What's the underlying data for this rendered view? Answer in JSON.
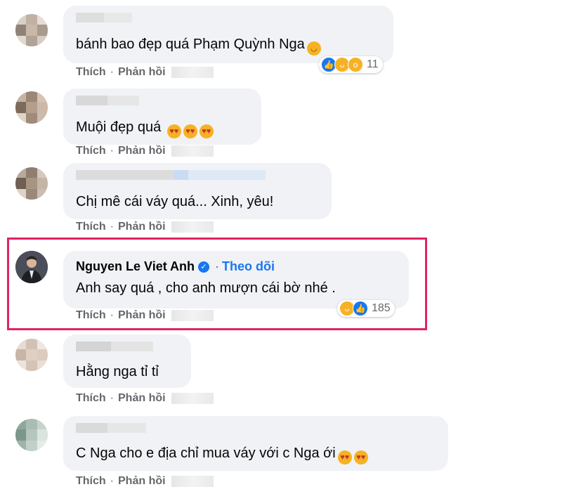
{
  "actions": {
    "like": "Thích",
    "sep": "·",
    "reply": "Phản hồi"
  },
  "comments": [
    {
      "text": "bánh bao đẹp quá Phạm Quỳnh Nga",
      "reaction_count": "11"
    },
    {
      "text": "Muội đẹp quá"
    },
    {
      "text": "Chị mê cái váy quá... Xinh, yêu!"
    },
    {
      "author": "Nguyen Le Viet Anh",
      "follow": "Theo dõi",
      "text": "Anh say quá , cho anh mượn cái bờ nhé .",
      "reaction_count": "185"
    },
    {
      "text": "Hằng nga tỉ tỉ"
    },
    {
      "text": "C Nga cho e địa chỉ mua váy với c Nga ới"
    }
  ],
  "colors": {
    "accent": "#1877f2",
    "highlight": "#e0245e",
    "bubble": "#f0f2f5"
  }
}
